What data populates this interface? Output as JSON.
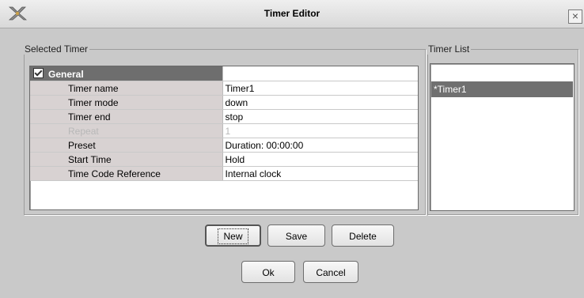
{
  "window": {
    "title": "Timer Editor",
    "close_glyph": "×",
    "icon": "app-logo-icon"
  },
  "selected_timer": {
    "legend": "Selected Timer",
    "section": "General",
    "rows": [
      {
        "label": "Timer name",
        "value": "Timer1",
        "disabled": false
      },
      {
        "label": "Timer mode",
        "value": "down",
        "disabled": false
      },
      {
        "label": "Timer end",
        "value": "stop",
        "disabled": false
      },
      {
        "label": "Repeat",
        "value": "1",
        "disabled": true
      },
      {
        "label": "Preset",
        "value": "Duration: 00:00:00",
        "disabled": false
      },
      {
        "label": "Start Time",
        "value": "Hold",
        "disabled": false
      },
      {
        "label": "Time Code Reference",
        "value": "Internal clock",
        "disabled": false
      }
    ]
  },
  "timer_list": {
    "legend": "Timer List",
    "items": [
      "*Timer1"
    ],
    "selected": "*Timer1"
  },
  "buttons": {
    "new": "New",
    "save": "Save",
    "delete": "Delete",
    "ok": "Ok",
    "cancel": "Cancel"
  },
  "colors": {
    "background": "#c9c9c9",
    "selection": "#707070",
    "label_cell": "#d8d2d2",
    "header": "#6e6e6e"
  }
}
